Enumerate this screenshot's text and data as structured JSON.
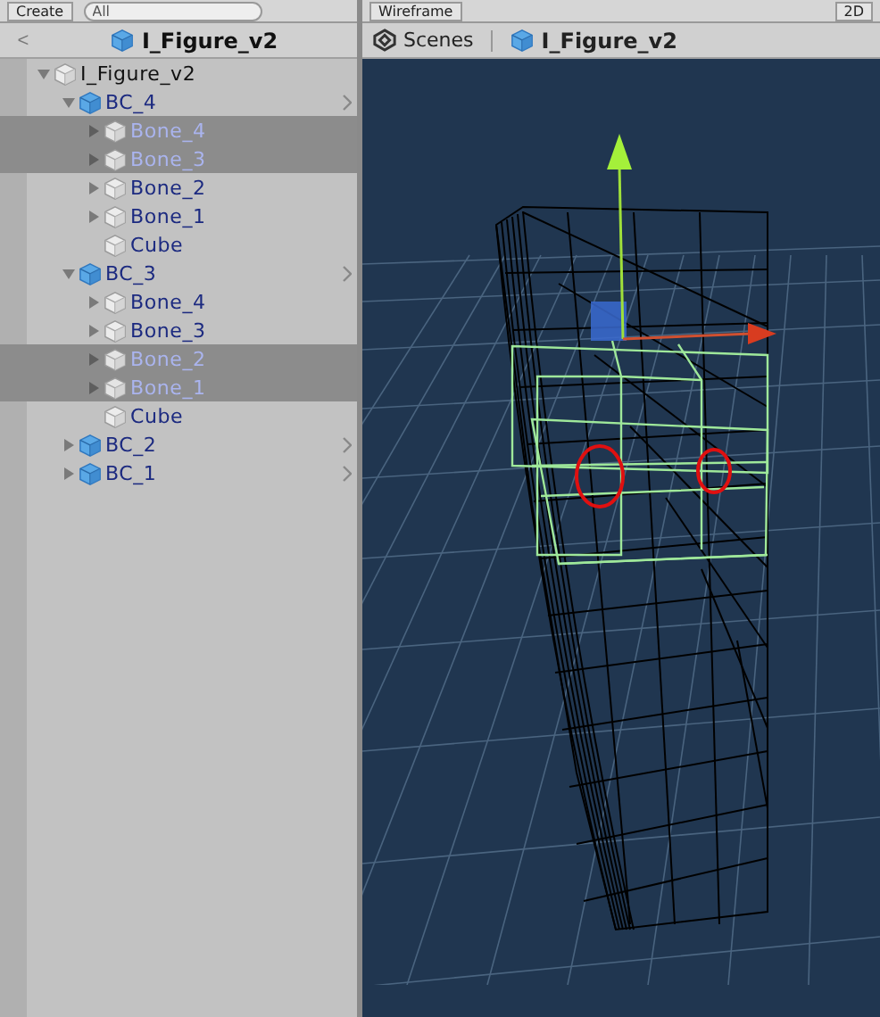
{
  "hierarchy_toolbar": {
    "create_label": "Create",
    "search_placeholder": "All"
  },
  "hierarchy_header": {
    "back": "<",
    "title": "I_Figure_v2"
  },
  "tree": [
    {
      "label": "I_Figure_v2",
      "kind": "object",
      "expanded": true,
      "selected": false,
      "children": [
        {
          "label": "BC_4",
          "kind": "prefab",
          "expanded": true,
          "selected": false,
          "children": [
            {
              "label": "Bone_4",
              "kind": "part",
              "expanded": false,
              "selected": true
            },
            {
              "label": "Bone_3",
              "kind": "part",
              "expanded": false,
              "selected": true
            },
            {
              "label": "Bone_2",
              "kind": "part",
              "expanded": false,
              "selected": false
            },
            {
              "label": "Bone_1",
              "kind": "part",
              "expanded": false,
              "selected": false
            },
            {
              "label": "Cube",
              "kind": "leaf",
              "selected": false
            }
          ]
        },
        {
          "label": "BC_3",
          "kind": "prefab",
          "expanded": true,
          "selected": false,
          "children": [
            {
              "label": "Bone_4",
              "kind": "part",
              "expanded": false,
              "selected": false
            },
            {
              "label": "Bone_3",
              "kind": "part",
              "expanded": false,
              "selected": false
            },
            {
              "label": "Bone_2",
              "kind": "part",
              "expanded": false,
              "selected": true
            },
            {
              "label": "Bone_1",
              "kind": "part",
              "expanded": false,
              "selected": true
            },
            {
              "label": "Cube",
              "kind": "leaf",
              "selected": false
            }
          ]
        },
        {
          "label": "BC_2",
          "kind": "prefab",
          "expanded": false,
          "selected": false
        },
        {
          "label": "BC_1",
          "kind": "prefab",
          "expanded": false,
          "selected": false
        }
      ]
    }
  ],
  "scene_toolbar": {
    "shading_mode": "Wireframe",
    "mode_2d": "2D"
  },
  "scene_breadcrumb": {
    "root": "Scenes",
    "current": "I_Figure_v2"
  }
}
